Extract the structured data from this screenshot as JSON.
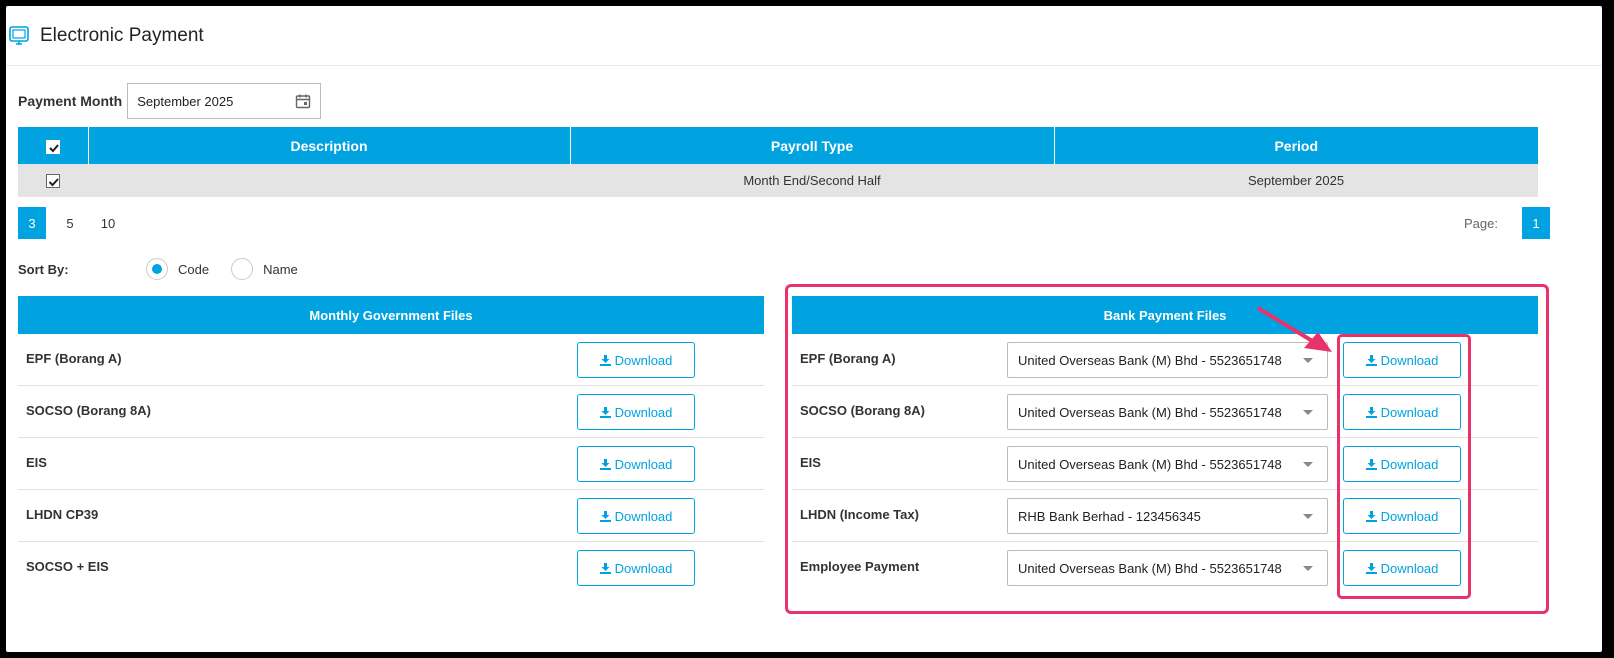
{
  "header": {
    "title": "Electronic Payment"
  },
  "payment_month": {
    "label": "Payment Month",
    "value": "September 2025"
  },
  "table": {
    "columns": [
      "Description",
      "Payroll Type",
      "Period"
    ],
    "rows": [
      {
        "description": "",
        "payroll_type": "Month End/Second Half",
        "period": "September 2025"
      }
    ]
  },
  "pager": {
    "sizes": [
      "3",
      "5",
      "10"
    ],
    "active_size": "3",
    "page_label": "Page:",
    "current_page": "1"
  },
  "sort": {
    "label": "Sort By:",
    "options": [
      "Code",
      "Name"
    ],
    "selected": "Code"
  },
  "gov_panel": {
    "title": "Monthly Government Files",
    "rows": [
      {
        "name": "EPF (Borang A)",
        "button": "Download"
      },
      {
        "name": "SOCSO (Borang 8A)",
        "button": "Download"
      },
      {
        "name": "EIS",
        "button": "Download"
      },
      {
        "name": "LHDN CP39",
        "button": "Download"
      },
      {
        "name": "SOCSO + EIS",
        "button": "Download"
      }
    ]
  },
  "bank_panel": {
    "title": "Bank Payment Files",
    "rows": [
      {
        "name": "EPF (Borang A)",
        "bank": "United Overseas Bank (M) Bhd - 5523651748",
        "button": "Download"
      },
      {
        "name": "SOCSO (Borang 8A)",
        "bank": "United Overseas Bank (M) Bhd - 5523651748",
        "button": "Download"
      },
      {
        "name": "EIS",
        "bank": "United Overseas Bank (M) Bhd - 5523651748",
        "button": "Download"
      },
      {
        "name": "LHDN (Income Tax)",
        "bank": "RHB Bank Berhad - 123456345",
        "button": "Download"
      },
      {
        "name": "Employee Payment",
        "bank": "United Overseas Bank (M) Bhd - 5523651748",
        "button": "Download"
      }
    ]
  },
  "colors": {
    "accent": "#00a2e0",
    "annotation": "#e8336a",
    "row_bg": "#e4e4e4"
  }
}
